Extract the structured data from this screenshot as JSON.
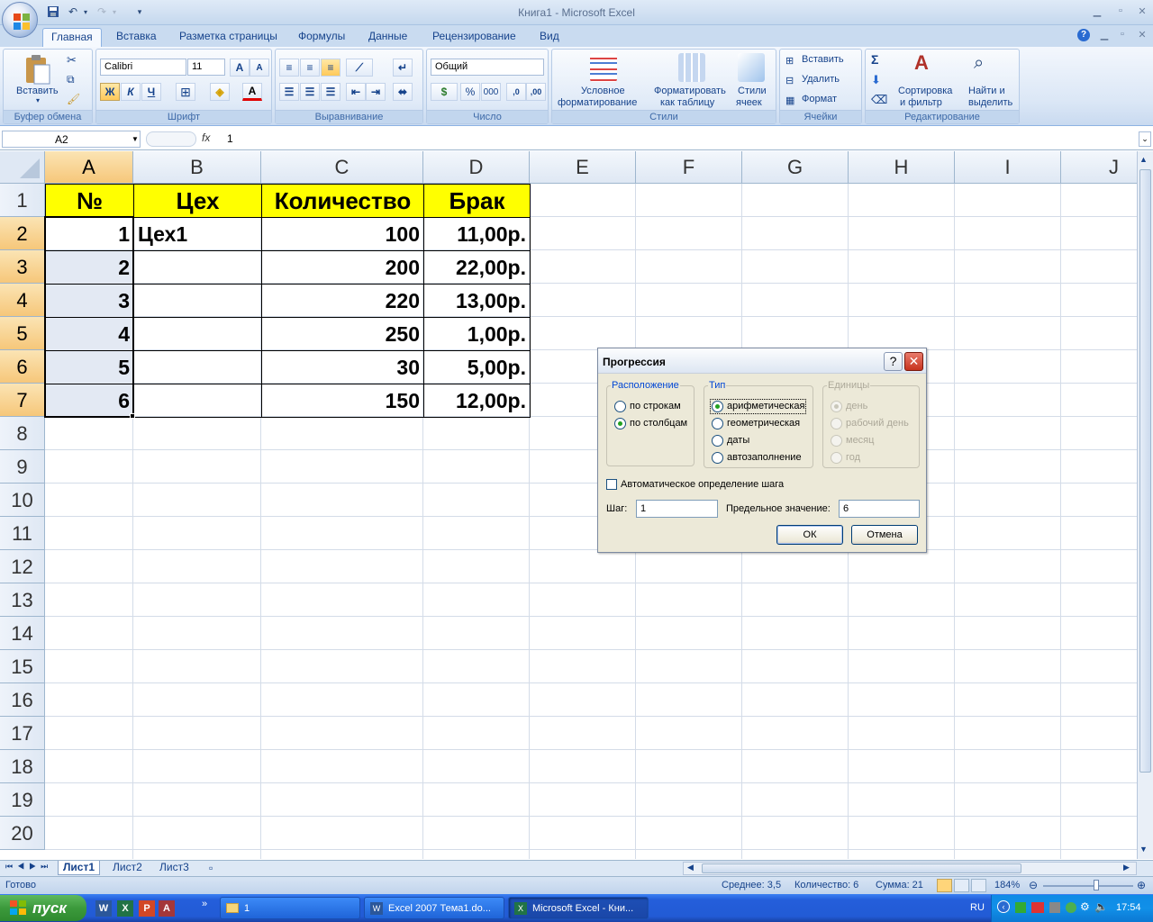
{
  "window": {
    "title": "Книга1 - Microsoft Excel"
  },
  "tabs": [
    "Главная",
    "Вставка",
    "Разметка страницы",
    "Формулы",
    "Данные",
    "Рецензирование",
    "Вид"
  ],
  "ribbon": {
    "paste_label": "Вставить",
    "clipboard_label": "Буфер обмена",
    "font_name": "Calibri",
    "font_size": "11",
    "bold": "Ж",
    "italic": "К",
    "underline": "Ч",
    "font_label": "Шрифт",
    "align_label": "Выравнивание",
    "number_format": "Общий",
    "number_label": "Число",
    "percent": "%",
    "thousands": "000",
    "cond_format_1": "Условное",
    "cond_format_2": "форматирование",
    "format_table_1": "Форматировать",
    "format_table_2": "как таблицу",
    "cell_styles_1": "Стили",
    "cell_styles_2": "ячеек",
    "styles_label": "Стили",
    "insert": "Вставить",
    "delete": "Удалить",
    "format": "Формат",
    "cells_label": "Ячейки",
    "sort_1": "Сортировка",
    "sort_2": "и фильтр",
    "find_1": "Найти и",
    "find_2": "выделить",
    "editing_label": "Редактирование"
  },
  "formula_bar": {
    "name_box": "A2",
    "fx": "fx",
    "value": "1"
  },
  "columns": [
    "A",
    "B",
    "C",
    "D",
    "E",
    "F",
    "G",
    "H",
    "I",
    "J"
  ],
  "rows": [
    "1",
    "2",
    "3",
    "4",
    "5",
    "6",
    "7",
    "8",
    "9",
    "10",
    "11",
    "12",
    "13",
    "14",
    "15",
    "16",
    "17",
    "18",
    "19",
    "20"
  ],
  "table": {
    "headers": [
      "№",
      "Цех",
      "Количество",
      "Брак"
    ],
    "data": [
      [
        "1",
        "Цех1",
        "100",
        "11,00р."
      ],
      [
        "2",
        "",
        "200",
        "22,00р."
      ],
      [
        "3",
        "",
        "220",
        "13,00р."
      ],
      [
        "4",
        "",
        "250",
        "1,00р."
      ],
      [
        "5",
        "",
        "30",
        "5,00р."
      ],
      [
        "6",
        "",
        "150",
        "12,00р."
      ]
    ]
  },
  "sheets": [
    "Лист1",
    "Лист2",
    "Лист3"
  ],
  "status": {
    "ready": "Готово",
    "average": "Среднее: 3,5",
    "count": "Количество: 6",
    "sum": "Сумма: 21",
    "zoom": "184%"
  },
  "dialog": {
    "title": "Прогрессия",
    "help": "?",
    "close": "✕",
    "location_legend": "Расположение",
    "by_rows": "по строкам",
    "by_columns": "по столбцам",
    "type_legend": "Тип",
    "arithmetic": "арифметическая",
    "geometric": "геометрическая",
    "dates": "даты",
    "autofill": "автозаполнение",
    "units_legend": "Единицы",
    "day": "день",
    "workday": "рабочий день",
    "month": "месяц",
    "year": "год",
    "auto_step": "Автоматическое определение шага",
    "step_label": "Шаг:",
    "step_value": "1",
    "limit_label": "Предельное значение:",
    "limit_value": "6",
    "ok": "ОК",
    "cancel": "Отмена"
  },
  "taskbar": {
    "start": "пуск",
    "task1": "1",
    "task2": "Excel 2007 Тема1.do...",
    "task3": "Microsoft Excel - Кни...",
    "lang": "RU",
    "time": "17:54"
  }
}
